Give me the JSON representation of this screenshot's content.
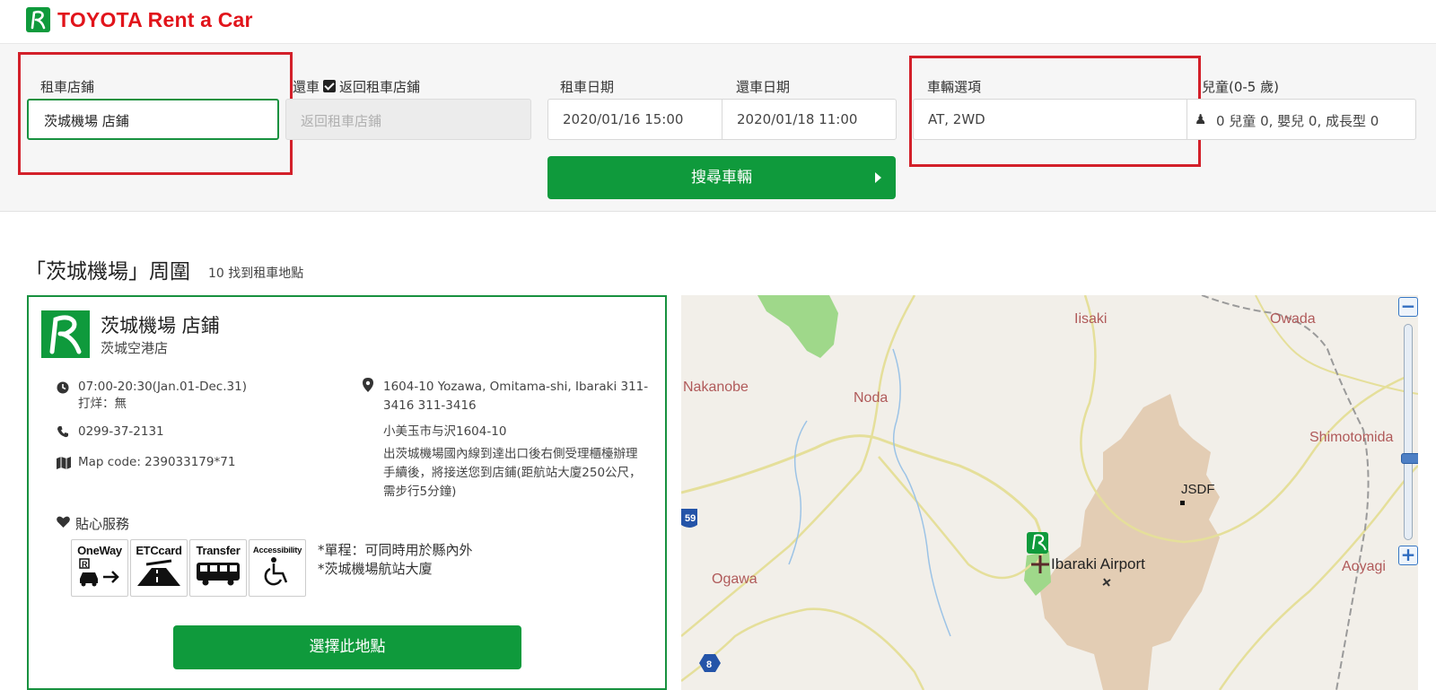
{
  "brand": {
    "name": "TOYOTA Rent a Car"
  },
  "search": {
    "pickup_label": "租車店鋪",
    "pickup_value": "茨城機場 店鋪",
    "return_label_prefix": "還車",
    "return_label": "返回租車店鋪",
    "return_checked": true,
    "return_placeholder": "返回租車店鋪",
    "pickup_date_label": "租車日期",
    "pickup_date_value": "2020/01/16 15:00",
    "return_date_label": "還車日期",
    "return_date_value": "2020/01/18 11:00",
    "vehicle_label": "車輛選項",
    "vehicle_value": "AT, 2WD",
    "child_label": "兒童(0-5 歲)",
    "child_value": "0 兒童 0, 嬰兒 0, 成長型 0",
    "search_button": "搜尋車輛"
  },
  "results": {
    "heading": "「茨城機場」周圍",
    "count": "10 找到租車地點"
  },
  "store": {
    "name": "茨城機場 店鋪",
    "subname": "茨城空港店",
    "hours": "07:00-20:30(Jan.01-Dec.31)",
    "closed": "打烊：無",
    "phone": "0299-37-2131",
    "map_code": "Map code: 239033179*71",
    "address": "1604-10 Yozawa, Omitama-shi, Ibaraki 311-3416 311-3416",
    "address_jp": "小美玉市与沢1604-10",
    "directions": "出茨城機場國內線到達出口後右側受理櫃檯辦理手續後，將接送您到店鋪(距航站大廈250公尺，需步行5分鐘)",
    "services_title": "貼心服務",
    "badges": [
      "OneWay",
      "ETCcard",
      "Transfer",
      "Accessibility"
    ],
    "note1": "*單程：可同時用於縣內外",
    "note2": "*茨城機場航站大廈",
    "select_button": "選擇此地點"
  },
  "map": {
    "places": [
      "Iisaki",
      "Owada",
      "Nakanobe",
      "Noda",
      "Shimotomida",
      "JSDF",
      "Ibaraki Airport",
      "Ogawa",
      "Aoyagi"
    ],
    "route_shields": [
      "59",
      "8"
    ]
  },
  "colors": {
    "brand_green": "#0f9a3c",
    "brand_red": "#e1141b",
    "highlight_red": "#d3202a"
  }
}
